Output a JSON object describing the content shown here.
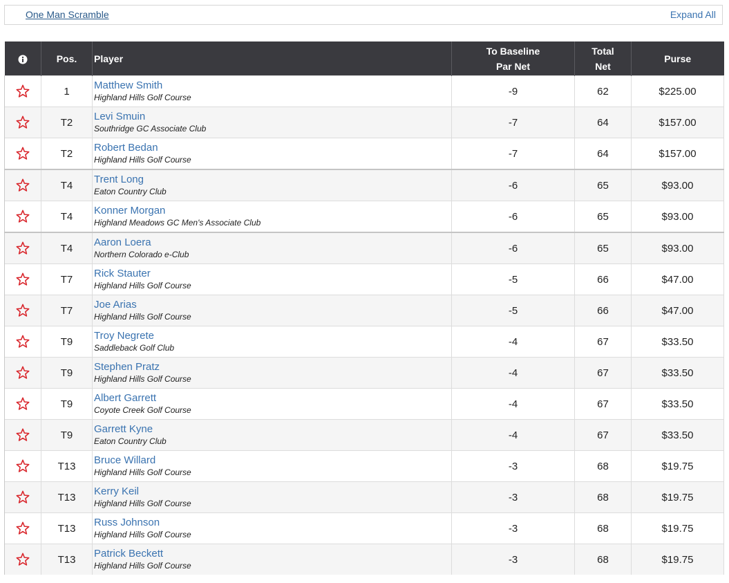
{
  "header": {
    "round_label": "One Man Scramble",
    "expand_label": "Expand All"
  },
  "columns": {
    "info": "i",
    "pos": "Pos.",
    "player": "Player",
    "baseline_line1": "To Baseline",
    "baseline_line2": "Par Net",
    "total_line1": "Total",
    "total_line2": "Net",
    "purse": "Purse"
  },
  "icons": {
    "favorite": "star-outline-icon",
    "info": "info-circle-icon"
  },
  "colors": {
    "header_bg": "#3a3a3f",
    "link": "#3a73b0",
    "star": "#d9262c"
  },
  "rows": [
    {
      "pos": "1",
      "name": "Matthew Smith",
      "club": "Highland Hills Golf Course",
      "to_par": "-9",
      "total": "62",
      "purse": "$225.00"
    },
    {
      "pos": "T2",
      "name": "Levi Smuin",
      "club": "Southridge GC Associate Club",
      "to_par": "-7",
      "total": "64",
      "purse": "$157.00"
    },
    {
      "pos": "T2",
      "name": "Robert Bedan",
      "club": "Highland Hills Golf Course",
      "to_par": "-7",
      "total": "64",
      "purse": "$157.00"
    },
    {
      "pos": "T4",
      "name": "Trent Long",
      "club": "Eaton Country Club",
      "to_par": "-6",
      "total": "65",
      "purse": "$93.00"
    },
    {
      "pos": "T4",
      "name": "Konner Morgan",
      "club": "Highland Meadows GC Men's Associate Club",
      "to_par": "-6",
      "total": "65",
      "purse": "$93.00"
    },
    {
      "pos": "T4",
      "name": "Aaron Loera",
      "club": "Northern Colorado e-Club",
      "to_par": "-6",
      "total": "65",
      "purse": "$93.00"
    },
    {
      "pos": "T7",
      "name": "Rick Stauter",
      "club": "Highland Hills Golf Course",
      "to_par": "-5",
      "total": "66",
      "purse": "$47.00"
    },
    {
      "pos": "T7",
      "name": "Joe Arias",
      "club": "Highland Hills Golf Course",
      "to_par": "-5",
      "total": "66",
      "purse": "$47.00"
    },
    {
      "pos": "T9",
      "name": "Troy Negrete",
      "club": "Saddleback Golf Club",
      "to_par": "-4",
      "total": "67",
      "purse": "$33.50"
    },
    {
      "pos": "T9",
      "name": "Stephen Pratz",
      "club": "Highland Hills Golf Course",
      "to_par": "-4",
      "total": "67",
      "purse": "$33.50"
    },
    {
      "pos": "T9",
      "name": "Albert Garrett",
      "club": "Coyote Creek Golf Course",
      "to_par": "-4",
      "total": "67",
      "purse": "$33.50"
    },
    {
      "pos": "T9",
      "name": "Garrett Kyne",
      "club": "Eaton Country Club",
      "to_par": "-4",
      "total": "67",
      "purse": "$33.50"
    },
    {
      "pos": "T13",
      "name": "Bruce Willard",
      "club": "Highland Hills Golf Course",
      "to_par": "-3",
      "total": "68",
      "purse": "$19.75"
    },
    {
      "pos": "T13",
      "name": "Kerry Keil",
      "club": "Highland Hills Golf Course",
      "to_par": "-3",
      "total": "68",
      "purse": "$19.75"
    },
    {
      "pos": "T13",
      "name": "Russ Johnson",
      "club": "Highland Hills Golf Course",
      "to_par": "-3",
      "total": "68",
      "purse": "$19.75"
    },
    {
      "pos": "T13",
      "name": "Patrick Beckett",
      "club": "Highland Hills Golf Course",
      "to_par": "-3",
      "total": "68",
      "purse": "$19.75"
    }
  ]
}
